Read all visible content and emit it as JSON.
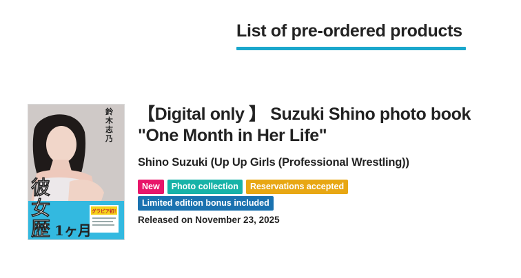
{
  "section": {
    "title": "List of pre-ordered products",
    "accent_color": "#1aa7cc"
  },
  "product": {
    "cover": {
      "vertical_name": "鈴木志乃",
      "title_chars": [
        "彼",
        "女",
        "歴"
      ],
      "title_suffix": "1ヶ月",
      "badge": "グラビア初！",
      "accent_color": "#33b9e0"
    },
    "title_line1": "【Digital only 】 Suzuki Shino photo book",
    "title_line2": "\"One Month in Her Life\"",
    "artist": "Shino Suzuki (Up Up Girls (Professional Wrestling))",
    "tags": [
      {
        "label": "New",
        "color": "#e8166a"
      },
      {
        "label": "Photo collection",
        "color": "#17b3a8"
      },
      {
        "label": "Reservations accepted",
        "color": "#e8a713"
      },
      {
        "label": "Limited edition bonus included",
        "color": "#1a72b0"
      }
    ],
    "release": "Released on November 23, 2025"
  }
}
